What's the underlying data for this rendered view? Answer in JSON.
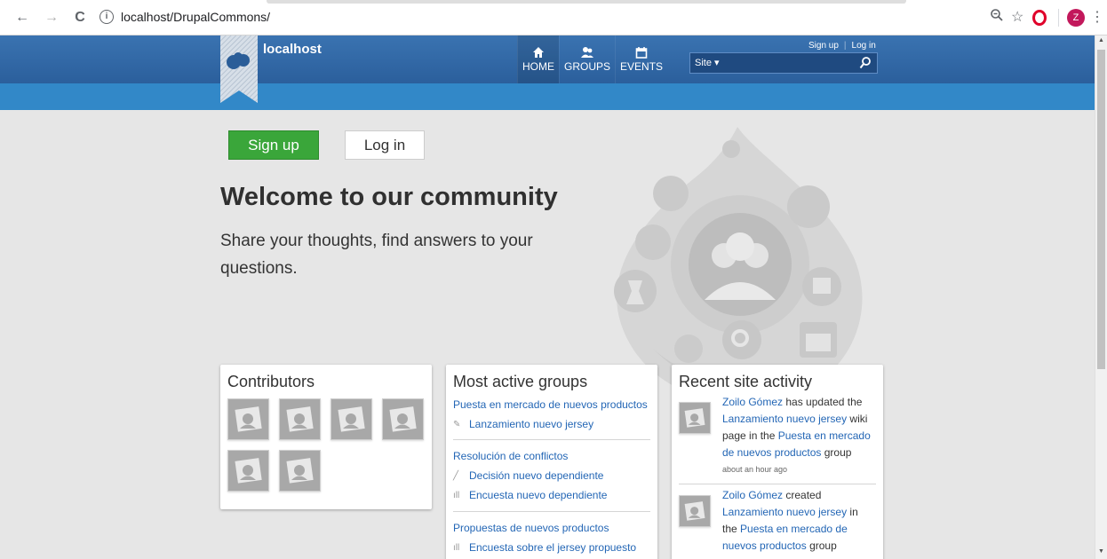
{
  "browser": {
    "back": "←",
    "forward": "→",
    "reload": "C",
    "url": "localhost/DrupalCommons/",
    "zoom_icon": "zoom-icon",
    "star_icon": "star-icon",
    "avatar_letter": "Z"
  },
  "header": {
    "site_name": "localhost",
    "nav": [
      {
        "label": "HOME",
        "icon": "home-icon"
      },
      {
        "label": "GROUPS",
        "icon": "groups-icon"
      },
      {
        "label": "EVENTS",
        "icon": "calendar-icon"
      }
    ],
    "signup": "Sign up",
    "login": "Log in",
    "search_scope": "Site ▾",
    "search_placeholder": ""
  },
  "hero": {
    "signup_button": "Sign up",
    "login_button": "Log in",
    "title": "Welcome to our community",
    "text": "Share your thoughts, find answers to your questions."
  },
  "contributors": {
    "title": "Contributors",
    "count": 6
  },
  "groups": {
    "title": "Most active groups",
    "items": [
      {
        "name": "Puesta en mercado de nuevos productos",
        "subs": [
          {
            "icon": "edit-icon",
            "label": "Lanzamiento nuevo jersey"
          }
        ]
      },
      {
        "name": "Resolución de conflictos",
        "subs": [
          {
            "icon": "pencil-icon",
            "label": "Decisión nuevo dependiente"
          },
          {
            "icon": "poll-icon",
            "label": "Encuesta nuevo dependiente"
          }
        ]
      },
      {
        "name": "Propuestas de nuevos productos",
        "subs": [
          {
            "icon": "poll-icon",
            "label": "Encuesta sobre el jersey propuesto"
          }
        ]
      }
    ]
  },
  "activity": {
    "title": "Recent site activity",
    "items": [
      {
        "user": "Zoilo Gómez",
        "a": " has updated the ",
        "node": "Lanzamiento nuevo jersey",
        "b": " wiki page in the ",
        "group": "Puesta en mercado de nuevos productos",
        "c": " group",
        "time": "about an hour ago"
      },
      {
        "user": "Zoilo Gómez",
        "a": " created ",
        "node": "Lanzamiento nuevo jersey",
        "b": " in the ",
        "group": "Puesta en mercado de nuevos productos",
        "c": " group",
        "time": ""
      }
    ]
  },
  "colors": {
    "header": "#2f67a6",
    "subbar": "#3288c8",
    "signup": "#3aa63a",
    "link": "#2366b5"
  }
}
